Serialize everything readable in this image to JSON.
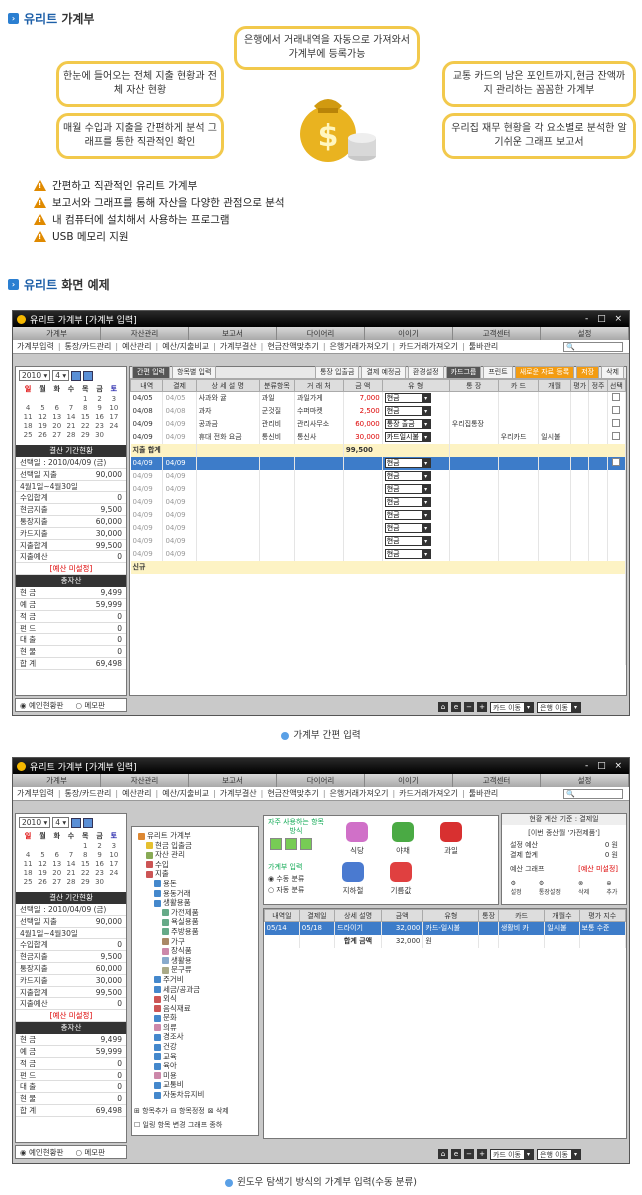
{
  "section1": {
    "title_a": "유리트",
    "title_b": "가계부"
  },
  "bubbles": {
    "b1": "은행에서 거래내역을 자동으로 가져와서 가계부에 등록가능",
    "b2": "한눈에 들어오는 전체 지출 현황과 전체 자산 현황",
    "b3": "교통 카드의 남은 포인트까지,현금 잔액까지 관리하는 꼼꼼한 가계부",
    "b4": "매월 수입과 지출을 간편하게 분석 그래프를 통한 직관적인 확인",
    "b5": "우리집 재무 현황을 각 요소별로 분석한 알기쉬운 그래프 보고서"
  },
  "features": [
    "간편하고 직관적인 유리트 가계부",
    "보고서와 그래프를 통해 자산을 다양한 관점으로 분석",
    "내 컴퓨터에 설치해서 사용하는 프로그램",
    "USB 메모리 지원"
  ],
  "section2": {
    "title_a": "유리트",
    "title_b": "화면 예제"
  },
  "window": {
    "title": "유리트 가계부  [가계부 입력]",
    "title2": "유리트 가계부  [가계부 입력]",
    "ctrl": "- □ ×",
    "menu": [
      "가계부",
      "자산관리",
      "보고서",
      "다이어리",
      "이이기",
      "고객센터",
      "설정"
    ],
    "toolbar": [
      "가계부입력",
      "통장/카드관리",
      "예산관리",
      "예산/지출비교",
      "가계부결산",
      "현금잔액맞추기",
      "은행거래가져오기",
      "카드거래가져오기",
      "툴바관리"
    ]
  },
  "calendar": {
    "year": "2010",
    "month": "4",
    "heads": [
      "일",
      "월",
      "화",
      "수",
      "목",
      "금",
      "토"
    ],
    "days": [
      "",
      "",
      "",
      "",
      "1",
      "2",
      "3",
      "4",
      "5",
      "6",
      "7",
      "8",
      "9",
      "10",
      "11",
      "12",
      "13",
      "14",
      "15",
      "16",
      "17",
      "18",
      "19",
      "20",
      "21",
      "22",
      "23",
      "24",
      "25",
      "26",
      "27",
      "28",
      "29",
      "30",
      ""
    ]
  },
  "summary": {
    "header": "결산 기간현황",
    "rows": [
      {
        "k": "선택일 : 2010/04/09 (금)",
        "v": ""
      },
      {
        "k": "선택일 지출",
        "v": "90,000"
      },
      {
        "k": "4월1일~4월30일",
        "v": ""
      },
      {
        "k": "수입합계",
        "v": "0"
      },
      {
        "k": "현금지출",
        "v": "9,500"
      },
      {
        "k": "통장지출",
        "v": "60,000"
      },
      {
        "k": "카드지출",
        "v": "30,000"
      },
      {
        "k": "지출합계",
        "v": "99,500"
      },
      {
        "k": "지출예산",
        "v": "0"
      }
    ],
    "budget_warn": "[예산 미설정]",
    "asset_header": "총자산",
    "assets": [
      {
        "k": "현 금",
        "v": "9,499"
      },
      {
        "k": "예 금",
        "v": "59,999"
      },
      {
        "k": "적 금",
        "v": "0"
      },
      {
        "k": "펀 드",
        "v": "0"
      },
      {
        "k": "대 출",
        "v": "0"
      },
      {
        "k": "현 물",
        "v": "0"
      },
      {
        "k": "합 계",
        "v": "69,498"
      }
    ]
  },
  "radios": [
    "예인현황판",
    "메모판"
  ],
  "tabs1": [
    "간편 입력",
    "항목별 입력",
    "통장 입출금",
    "결제 예정금",
    "환경설정",
    "카드그룹",
    "프린트",
    "새로운 자료 등록",
    "저장",
    "삭제"
  ],
  "table": {
    "headers": [
      "내역",
      "결제",
      "상 세 설 명",
      "분류항목",
      "거 래 처",
      "금 액",
      "유 형",
      "통 장",
      "카 드",
      "개월",
      "평가",
      "정주",
      "선택"
    ],
    "rows": [
      {
        "d": "04/05",
        "e": "04/05",
        "desc": "사과와 귤",
        "cat": "과일",
        "shop": "과일가게",
        "amt": "7,000",
        "type": "현금",
        "bank": "",
        "card": "",
        "mon": ""
      },
      {
        "d": "04/08",
        "e": "04/08",
        "desc": "과자",
        "cat": "군것질",
        "shop": "수퍼마켓",
        "amt": "2,500",
        "type": "현금",
        "bank": "",
        "card": "",
        "mon": ""
      },
      {
        "d": "04/09",
        "e": "04/09",
        "desc": "공과금",
        "cat": "관리비",
        "shop": "관리사무소",
        "amt": "60,000",
        "type": "통장 출금",
        "bank": "우리집통장",
        "card": "",
        "mon": ""
      },
      {
        "d": "04/09",
        "e": "04/09",
        "desc": "휴대 전화 요금",
        "cat": "통신비",
        "shop": "통신사",
        "amt": "30,000",
        "type": "카드일시불",
        "bank": "",
        "card": "우리카드",
        "mon": "일시불"
      }
    ],
    "sum_label": "지출 합계",
    "sum_value": "99,500",
    "empty_date": "04/09",
    "empty_type": "현금",
    "new_label": "신규"
  },
  "bottom": {
    "card": "카드 이동",
    "bank": "은행 이동"
  },
  "caption1": "가계부 간편 입력",
  "caption2": "윈도우 탐색기 방식의 가계부 입력(수동 분류)",
  "tree": {
    "items": [
      "유리트 가계부",
      "현금 입출금",
      "자산 관리",
      "수입",
      "지출",
      "용돈",
      "용동거래",
      "생활용품",
      "가전제품",
      "욕실용품",
      "주방용품",
      "가구",
      "장식품",
      "생활용",
      "문구류",
      "주거비",
      "세금/공과금",
      "외식",
      "음식재료",
      "문화",
      "의류",
      "경조사",
      "건강",
      "교육",
      "육아",
      "미용",
      "교통비",
      "자동차유지비"
    ],
    "buttons": [
      "항목추가",
      "항목정정",
      "삭제"
    ],
    "check": "일링 항목 변경 그래프 종하"
  },
  "quick": {
    "title": "자주 사용하는 항목 방식",
    "input_mode": "가계부 입력",
    "modes": [
      "수동 분류",
      "자동 분류"
    ],
    "cats": [
      "식당",
      "야채",
      "과일",
      "지하철",
      "기름값"
    ]
  },
  "settle": {
    "title": "현황 계산 기준 : 결제일",
    "sub": "[이번 종산월 '가전제품']",
    "rows": [
      {
        "k": "설정 예산",
        "v": "0 원"
      },
      {
        "k": "결제 합계",
        "v": "0 원"
      }
    ],
    "graph_label": "예산 그래프",
    "graph_warn": "[예산 미설정]",
    "icons": [
      "설정",
      "통장설정",
      "삭제",
      "추가"
    ]
  },
  "table2": {
    "headers": [
      "내역일",
      "결제일",
      "상세 설명",
      "금액",
      "유형",
      "통장",
      "카드",
      "개월수",
      "평가 지수"
    ],
    "row": {
      "d": "05/14",
      "e": "05/18",
      "desc": "드라이기",
      "amt": "32,000",
      "type": "카드-일시불",
      "bank": "",
      "card": "생활비 카",
      "mon": "일시불",
      "eval": "보통 수준"
    },
    "sum_label": "합계 금액",
    "sum_value": "32,000",
    "sum_unit": "원"
  },
  "colors": {
    "accent": "#1d5fa8",
    "bubble_border": "#f2c94c",
    "selected": "#3d7cc9",
    "warn": "#e08a00"
  }
}
